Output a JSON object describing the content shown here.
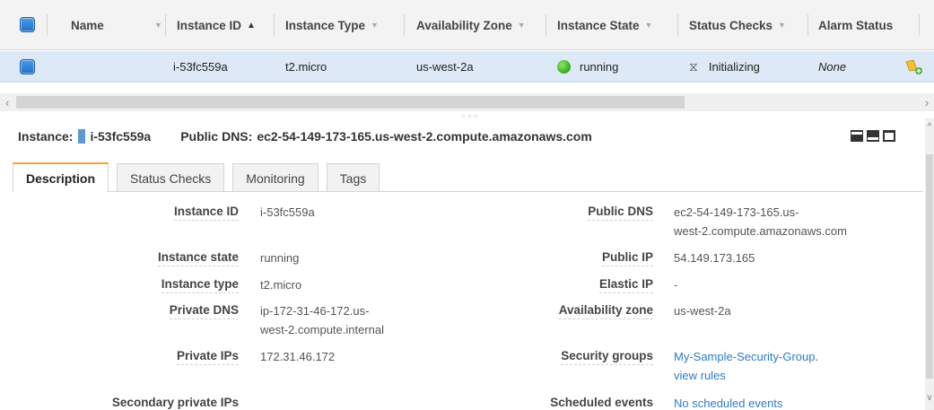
{
  "columns": {
    "name": "Name",
    "instance_id": "Instance ID",
    "instance_type": "Instance Type",
    "availability_zone": "Availability Zone",
    "instance_state": "Instance State",
    "status_checks": "Status Checks",
    "alarm_status": "Alarm Status"
  },
  "row": {
    "instance_id": "i-53fc559a",
    "instance_type": "t2.micro",
    "availability_zone": "us-west-2a",
    "instance_state": "running",
    "status_checks": "Initializing",
    "alarm_status": "None"
  },
  "detail": {
    "instance_label": "Instance:",
    "instance_id": "i-53fc559a",
    "public_dns_label": "Public DNS:",
    "public_dns": "ec2-54-149-173-165.us-west-2.compute.amazonaws.com"
  },
  "tabs": [
    "Description",
    "Status Checks",
    "Monitoring",
    "Tags"
  ],
  "description": {
    "left": [
      {
        "label": "Instance ID",
        "value": "i-53fc559a"
      },
      {
        "label": "Instance state",
        "value": "running"
      },
      {
        "label": "Instance type",
        "value": "t2.micro"
      },
      {
        "label": "Private DNS",
        "value_line1": "ip-172-31-46-172.us-",
        "value_line2": "west-2.compute.internal"
      },
      {
        "label": "Private IPs",
        "value": "172.31.46.172"
      },
      {
        "label": "Secondary private IPs",
        "value": ""
      }
    ],
    "right": [
      {
        "label": "Public DNS",
        "value_line1": "ec2-54-149-173-165.us-",
        "value_line2": "west-2.compute.amazonaws.com"
      },
      {
        "label": "Public IP",
        "value": "54.149.173.165"
      },
      {
        "label": "Elastic IP",
        "value": "-"
      },
      {
        "label": "Availability zone",
        "value": "us-west-2a"
      },
      {
        "label": "Security groups",
        "value_line1": "My-Sample-Security-Group",
        "separator": ".",
        "value_line2": "view rules"
      },
      {
        "label": "Scheduled events",
        "value": "No scheduled events"
      }
    ]
  },
  "colors": {
    "accent_tab": "#f0a33a",
    "selected_row": "#dde9f7",
    "link": "#2e7cc4",
    "running": "#34a81c"
  },
  "icons": [
    "checkbox-icon",
    "sort-caret-icon",
    "status-running-icon",
    "hourglass-icon",
    "alarm-add-icon",
    "layout-icon"
  ]
}
